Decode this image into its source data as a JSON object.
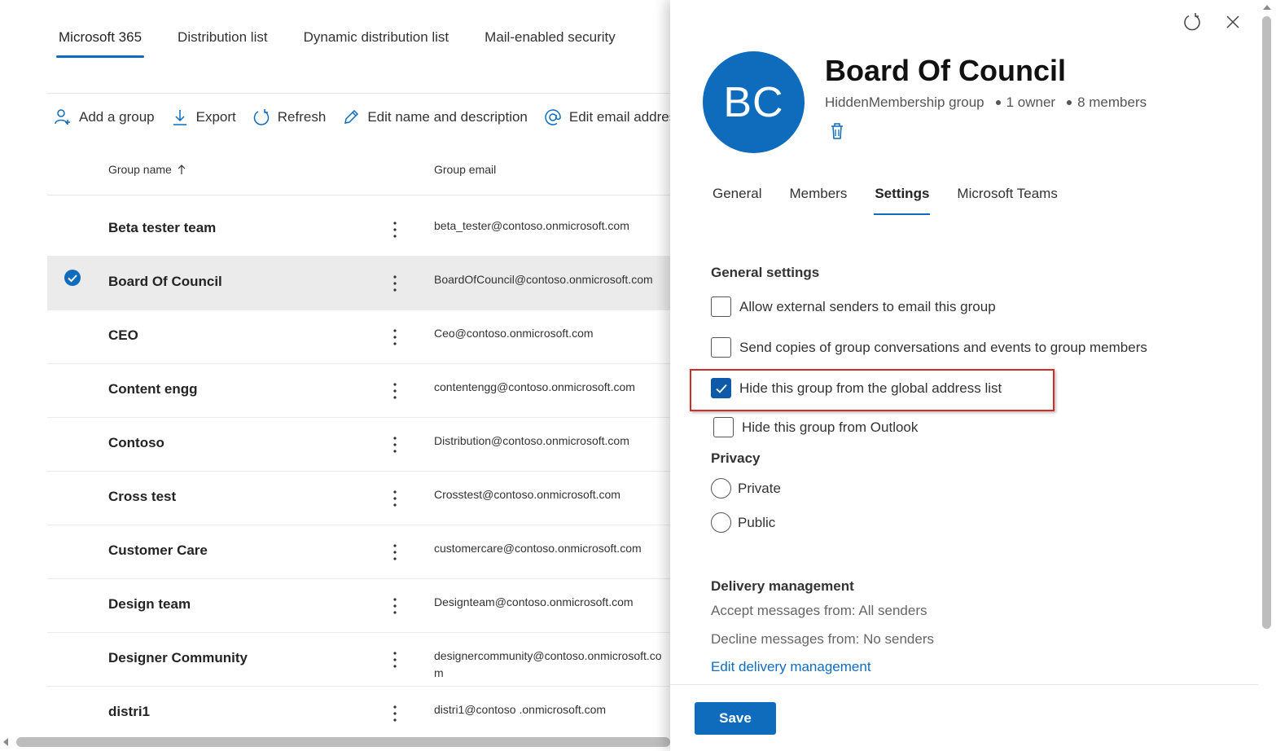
{
  "tabs": [
    {
      "label": "Microsoft 365",
      "active": true
    },
    {
      "label": "Distribution list",
      "active": false
    },
    {
      "label": "Dynamic distribution list",
      "active": false
    },
    {
      "label": "Mail-enabled security",
      "active": false
    }
  ],
  "toolbar": {
    "add_group": "Add a group",
    "export": "Export",
    "refresh": "Refresh",
    "edit_name": "Edit name and description",
    "edit_email": "Edit email address"
  },
  "table": {
    "col_group_name": "Group name",
    "col_group_email": "Group email",
    "rows": [
      {
        "name": "Beta tester team",
        "email": "beta_tester@contoso.onmicrosoft.com",
        "selected": false
      },
      {
        "name": "Board Of Council",
        "email": "BoardOfCouncil@contoso.onmicrosoft.com",
        "selected": true
      },
      {
        "name": "CEO",
        "email": "Ceo@contoso.onmicrosoft.com",
        "selected": false
      },
      {
        "name": "Content engg",
        "email": "contentengg@contoso.onmicrosoft.com",
        "selected": false
      },
      {
        "name": "Contoso",
        "email": "Distribution@contoso.onmicrosoft.com",
        "selected": false
      },
      {
        "name": "Cross test",
        "email": "Crosstest@contoso.onmicrosoft.com",
        "selected": false
      },
      {
        "name": "Customer Care",
        "email": "customercare@contoso.onmicrosoft.com",
        "selected": false
      },
      {
        "name": "Design team",
        "email": "Designteam@contoso.onmicrosoft.com",
        "selected": false
      },
      {
        "name": "Designer Community",
        "email": "designercommunity@contoso.onmicrosoft.com",
        "selected": false
      },
      {
        "name": "distri1",
        "email": "distri1@contoso .onmicrosoft.com",
        "selected": false
      }
    ]
  },
  "panel": {
    "avatar_initials": "BC",
    "title": "Board Of Council",
    "group_type": "HiddenMembership group",
    "owners": "1 owner",
    "members": "8 members",
    "tabs": [
      "General",
      "Members",
      "Settings",
      "Microsoft Teams"
    ],
    "active_tab": "Settings",
    "general_settings_title": "General settings",
    "options": {
      "allow_external": {
        "label": "Allow external senders to email this group",
        "checked": false
      },
      "send_copies": {
        "label": "Send copies of group conversations and events to group members",
        "checked": false
      },
      "hide_gal": {
        "label": "Hide this group from the global address list",
        "checked": true
      },
      "hide_outlook": {
        "label": "Hide this group from Outlook",
        "checked": false
      }
    },
    "privacy_title": "Privacy",
    "privacy_private": "Private",
    "privacy_public": "Public",
    "delivery_title": "Delivery management",
    "accept_from": "Accept messages from: All senders",
    "decline_from": "Decline messages from: No senders",
    "edit_delivery": "Edit delivery management",
    "save_label": "Save"
  },
  "colors": {
    "accent": "#0f6cbd",
    "highlight": "#d62b2b",
    "selected_row": "#ebebeb"
  }
}
